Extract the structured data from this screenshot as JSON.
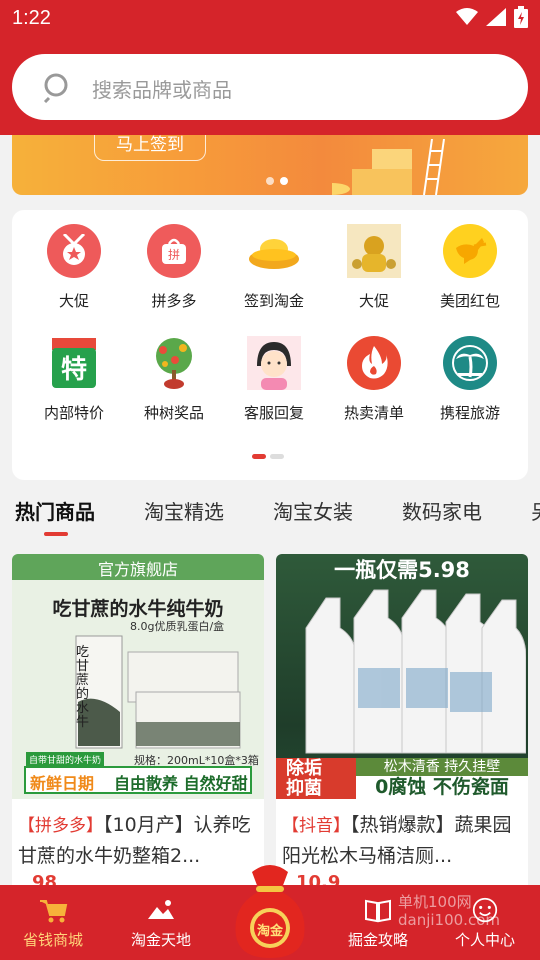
{
  "status": {
    "time": "1:22"
  },
  "search": {
    "placeholder": "搜索品牌或商品"
  },
  "banner": {
    "button_label": "马上签到",
    "page_count": 2,
    "active_page": 1
  },
  "categories": [
    {
      "label": "大促",
      "icon": "medal-icon"
    },
    {
      "label": "拼多多",
      "icon": "pinduoduo-bag-icon"
    },
    {
      "label": "签到淘金",
      "icon": "gold-ingot-icon"
    },
    {
      "label": "大促",
      "icon": "gold-figure-icon"
    },
    {
      "label": "美团红包",
      "icon": "meituan-kangaroo-icon"
    },
    {
      "label": "内部特价",
      "icon": "special-price-icon"
    },
    {
      "label": "种树奖品",
      "icon": "money-tree-icon"
    },
    {
      "label": "客服回复",
      "icon": "customer-service-girl-icon"
    },
    {
      "label": "热卖清单",
      "icon": "flame-icon"
    },
    {
      "label": "携程旅游",
      "icon": "palm-tree-icon"
    }
  ],
  "tabs": [
    "热门商品",
    "淘宝精选",
    "淘宝女装",
    "数码家电",
    "另"
  ],
  "products": [
    {
      "source": "【拼多多】",
      "title": "【10月产】认养吃甘蔗的水牛奶整箱2...",
      "image_texts": {
        "store": "官方旗舰店",
        "headline": "吃甘蔗的水牛纯牛奶",
        "protein": "8.0g优质乳蛋白/盒",
        "pack_name": "吃甘蔗的水牛",
        "spec": "规格：200mL*10盒*3箱",
        "slogan_small": "自带甘甜的水牛奶",
        "fresh": "新鲜日期",
        "free": "自由散养 自然好甜"
      },
      "price": "98"
    },
    {
      "source": "【抖音】",
      "title": "【热销爆款】蔬果园阳光松木马桶洁厕...",
      "image_texts": {
        "headline": "一瓶仅需5.98",
        "scent": "松木清香 持久挂壁",
        "remove": "除垢 抑菌",
        "nocorrode": "0腐蚀 不伤瓷面"
      },
      "price": "10.9"
    }
  ],
  "bottom_nav": [
    {
      "label": "省钱商城",
      "icon": "cart-icon",
      "active": true
    },
    {
      "label": "淘金天地",
      "icon": "landscape-icon",
      "active": false
    },
    {
      "label": "淘金",
      "icon": "lucky-bag-icon",
      "active": false
    },
    {
      "label": "掘金攻略",
      "icon": "book-icon",
      "active": false
    },
    {
      "label": "个人中心",
      "icon": "smiley-icon",
      "active": false
    }
  ],
  "watermark": {
    "line1": "单机100网",
    "line2": "danji100.com"
  }
}
